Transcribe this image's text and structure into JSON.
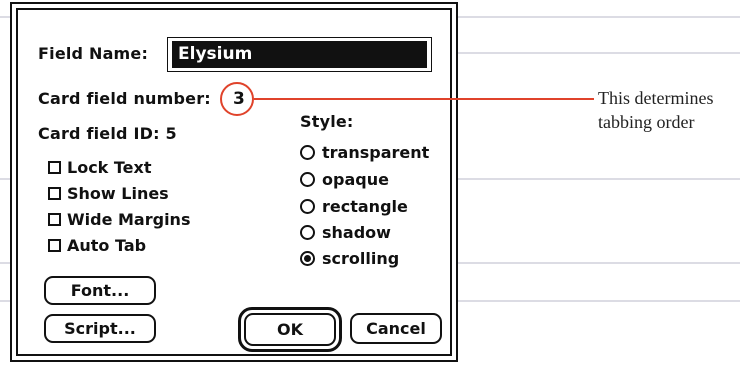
{
  "dialog": {
    "field_name_label": "Field Name:",
    "field_name_value": "Elysium",
    "card_field_number_label": "Card field number:",
    "card_field_number_value": "3",
    "card_field_id_label": "Card field ID: 5",
    "style_label": "Style:",
    "options": [
      {
        "label": "Lock Text",
        "checked": false
      },
      {
        "label": "Show Lines",
        "checked": false
      },
      {
        "label": "Wide Margins",
        "checked": false
      },
      {
        "label": "Auto Tab",
        "checked": false
      }
    ],
    "styles": [
      {
        "label": "transparent",
        "selected": false
      },
      {
        "label": "opaque",
        "selected": false
      },
      {
        "label": "rectangle",
        "selected": false
      },
      {
        "label": "shadow",
        "selected": false
      },
      {
        "label": "scrolling",
        "selected": true
      }
    ],
    "buttons": {
      "font": "Font...",
      "script": "Script...",
      "ok": "OK",
      "cancel": "Cancel"
    }
  },
  "annotation": {
    "text": "This determines tabbing order"
  },
  "colors": {
    "callout": "#e0432b",
    "dialog_border": "#111111",
    "field_highlight": "#111111"
  }
}
